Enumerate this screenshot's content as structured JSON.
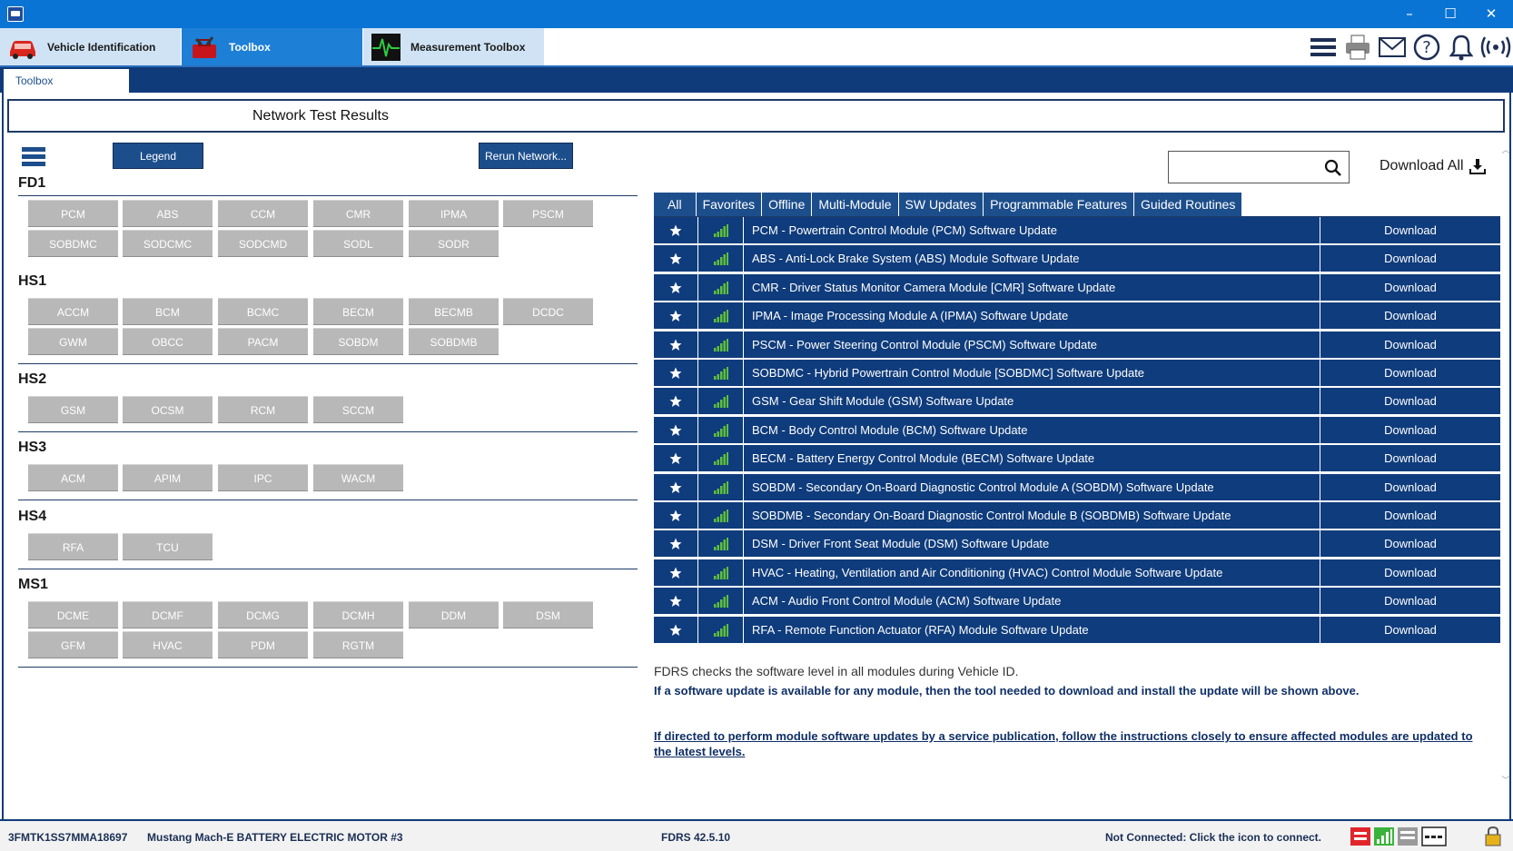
{
  "window": {
    "minimize": "–",
    "maximize": "☐",
    "close": "✕"
  },
  "tabs": [
    {
      "label": "Vehicle Identification"
    },
    {
      "label": "Toolbox"
    },
    {
      "label": "Measurement Toolbox"
    }
  ],
  "subtab": "Toolbox",
  "page_title": "Network Test Results",
  "buttons": {
    "legend": "Legend",
    "rerun": "Rerun Network..."
  },
  "search": {
    "placeholder": ""
  },
  "download_all": "Download All",
  "networks": [
    {
      "name": "FD1",
      "modules": [
        "PCM",
        "ABS",
        "CCM",
        "CMR",
        "IPMA",
        "PSCM",
        "SOBDMC",
        "SODCMC",
        "SODCMD",
        "SODL",
        "SODR"
      ]
    },
    {
      "name": "HS1",
      "modules": [
        "ACCM",
        "BCM",
        "BCMC",
        "BECM",
        "BECMB",
        "DCDC",
        "GWM",
        "OBCC",
        "PACM",
        "SOBDM",
        "SOBDMB"
      ]
    },
    {
      "name": "HS2",
      "modules": [
        "GSM",
        "OCSM",
        "RCM",
        "SCCM"
      ]
    },
    {
      "name": "HS3",
      "modules": [
        "ACM",
        "APIM",
        "IPC",
        "WACM"
      ]
    },
    {
      "name": "HS4",
      "modules": [
        "RFA",
        "TCU"
      ]
    },
    {
      "name": "MS1",
      "modules": [
        "DCME",
        "DCMF",
        "DCMG",
        "DCMH",
        "DDM",
        "DSM",
        "GFM",
        "HVAC",
        "PDM",
        "RGTM"
      ]
    }
  ],
  "filter_tabs": [
    "All",
    "Favorites",
    "Offline",
    "Multi-Module",
    "SW Updates",
    "Programmable Features",
    "Guided Routines"
  ],
  "updates": [
    "PCM - Powertrain Control Module (PCM) Software Update",
    "ABS - Anti-Lock Brake System (ABS) Module Software Update",
    "CMR - Driver Status Monitor Camera Module [CMR] Software Update",
    "IPMA - Image Processing Module A (IPMA) Software Update",
    "PSCM - Power Steering Control Module (PSCM) Software Update",
    "SOBDMC - Hybrid Powertrain Control Module [SOBDMC] Software Update",
    "GSM - Gear Shift Module (GSM) Software Update",
    "BCM - Body Control Module (BCM) Software Update",
    "BECM - Battery Energy Control Module (BECM) Software Update",
    "SOBDM - Secondary On-Board Diagnostic Control Module A (SOBDM) Software Update",
    "SOBDMB - Secondary On-Board Diagnostic Control Module B (SOBDMB) Software Update",
    "DSM - Driver Front Seat Module (DSM) Software Update",
    "HVAC - Heating, Ventilation and Air Conditioning (HVAC) Control Module Software Update",
    "ACM - Audio Front Control Module (ACM) Software Update",
    "RFA - Remote Function Actuator (RFA) Module Software Update"
  ],
  "download_label": "Download",
  "info": {
    "line1": "FDRS checks the software level in all modules during Vehicle ID.",
    "line2": "If a software update is available for any module, then the tool needed to download and install the update will be shown above.",
    "line3": "If directed to perform module software updates by a service publication, follow the instructions closely to ensure affected modules are updated to the latest levels."
  },
  "status": {
    "vin": "3FMTK1SS7MMA18697",
    "vehicle": "Mustang Mach-E BATTERY ELECTRIC MOTOR #3",
    "version": "FDRS 42.5.10",
    "connection": "Not Connected: Click the icon to connect."
  },
  "colors": {
    "navy": "#0f3c7c",
    "button": "#1d4e8c",
    "module": "#b8b8b8",
    "signal": "#5fbf3a"
  }
}
